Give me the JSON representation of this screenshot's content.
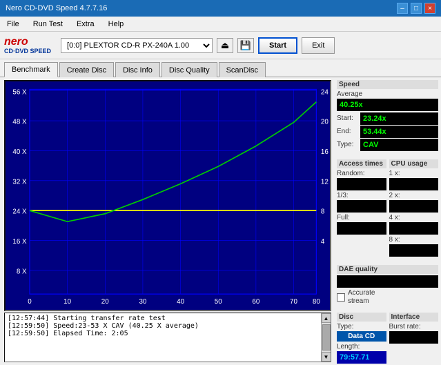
{
  "window": {
    "title": "Nero CD-DVD Speed 4.7.7.16",
    "controls": [
      "–",
      "□",
      "×"
    ]
  },
  "menu": {
    "items": [
      "File",
      "Run Test",
      "Extra",
      "Help"
    ]
  },
  "toolbar": {
    "logo_main": "nero",
    "logo_sub": "CD·DVD SPEED",
    "drive_value": "[0:0]  PLEXTOR CD-R  PX-240A 1.00",
    "start_label": "Start",
    "exit_label": "Exit"
  },
  "tabs": [
    {
      "label": "Benchmark",
      "active": true
    },
    {
      "label": "Create Disc",
      "active": false
    },
    {
      "label": "Disc Info",
      "active": false
    },
    {
      "label": "Disc Quality",
      "active": false
    },
    {
      "label": "ScanDisc",
      "active": false
    }
  ],
  "chart": {
    "y_left_labels": [
      "56 X",
      "48 X",
      "40 X",
      "32 X",
      "24 X",
      "16 X",
      "8 X",
      ""
    ],
    "y_right_labels": [
      "24",
      "20",
      "16",
      "12",
      "8",
      "4",
      ""
    ],
    "x_labels": [
      "0",
      "10",
      "20",
      "30",
      "40",
      "50",
      "60",
      "70",
      "80"
    ]
  },
  "speed_panel": {
    "title": "Speed",
    "average_label": "Average",
    "average_value": "40.25x",
    "start_label": "Start:",
    "start_value": "23.24x",
    "end_label": "End:",
    "end_value": "53.44x",
    "type_label": "Type:",
    "type_value": "CAV"
  },
  "access_panel": {
    "title": "Access times",
    "random_label": "Random:",
    "random_value": "",
    "one_third_label": "1/3:",
    "one_third_value": "",
    "full_label": "Full:",
    "full_value": ""
  },
  "cpu_panel": {
    "title": "CPU usage",
    "x1_label": "1 x:",
    "x1_value": "",
    "x2_label": "2 x:",
    "x2_value": "",
    "x4_label": "4 x:",
    "x4_value": "",
    "x8_label": "8 x:",
    "x8_value": ""
  },
  "dae_panel": {
    "title": "DAE quality",
    "value": "",
    "accurate_label": "Accurate",
    "stream_label": "stream"
  },
  "disc_panel": {
    "title": "Disc",
    "type_label": "Type:",
    "type_value": "Data CD",
    "length_label": "Length:",
    "length_value": "79:57.71"
  },
  "interface_panel": {
    "title": "Interface",
    "burst_label": "Burst rate:",
    "burst_value": ""
  },
  "log": {
    "entries": [
      "[12:57:44]  Starting transfer rate test",
      "[12:59:50]  Speed:23-53 X CAV (40.25 X average)",
      "[12:59:50]  Elapsed Time: 2:05"
    ]
  }
}
